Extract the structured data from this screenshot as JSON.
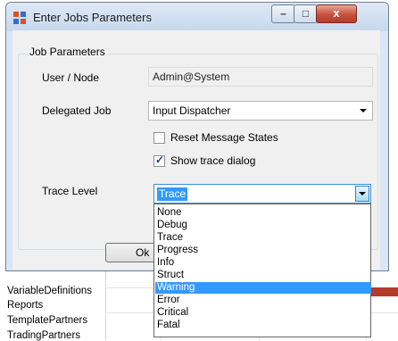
{
  "window": {
    "title": "Enter Jobs Parameters",
    "minimize_glyph": "–",
    "maximize_glyph": "□",
    "close_glyph": "x"
  },
  "group": {
    "legend": "Job Parameters"
  },
  "fields": {
    "user_node_label": "User / Node",
    "user_node_value": "Admin@System",
    "delegated_job_label": "Delegated Job",
    "delegated_job_value": "Input Dispatcher",
    "reset_label": "Reset Message States",
    "reset_checked": false,
    "show_trace_label": "Show trace dialog",
    "show_trace_checked": true,
    "trace_level_label": "Trace Level",
    "trace_level_value": "Trace"
  },
  "buttons": {
    "ok_label": "Ok"
  },
  "dropdown": {
    "options": [
      "None",
      "Debug",
      "Trace",
      "Progress",
      "Info",
      "Struct",
      "Warning",
      "Error",
      "Critical",
      "Fatal"
    ],
    "highlighted": "Warning"
  },
  "background_list": {
    "items": [
      "VariableDefinitions",
      "Reports",
      "TemplatePartners",
      "TradingPartners"
    ]
  },
  "colors": {
    "selection": "#3399ff",
    "close_button": "#c7503d"
  }
}
